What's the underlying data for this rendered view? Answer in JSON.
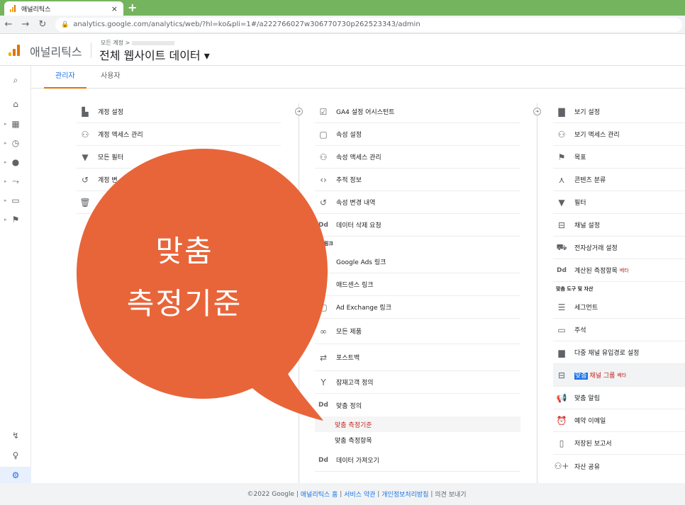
{
  "browser": {
    "tab_title": "애널리틱스",
    "tab_close": "×",
    "new_tab": "+",
    "url": "analytics.google.com/analytics/web/?hl=ko&pli=1#/a222766027w306770730p262523343/admin"
  },
  "header": {
    "app_name": "애널리틱스",
    "breadcrumb": "모든 계정 >",
    "property": "전체 웹사이트 데이터 ▾"
  },
  "subtabs": [
    "관리자",
    "사용자"
  ],
  "account_column": [
    {
      "icon": "building-icon",
      "label": "계정 설정"
    },
    {
      "icon": "people-icon",
      "label": "계정 액세스 관리"
    },
    {
      "icon": "filter-icon",
      "label": "모든 필터"
    },
    {
      "icon": "history-icon",
      "label": "계정 변"
    },
    {
      "icon": "trash-icon",
      "label": ""
    }
  ],
  "property_column": {
    "items": [
      {
        "icon": "check-icon",
        "label": "GA4 설정 어시스턴트"
      },
      {
        "icon": "window-icon",
        "label": "속성 설정"
      },
      {
        "icon": "people-icon",
        "label": "속성 액세스 관리"
      },
      {
        "icon": "code-icon",
        "label": "추적 정보"
      },
      {
        "icon": "history-icon",
        "label": "속성 변경 내역"
      },
      {
        "icon": "dd-icon",
        "label": "데이터 삭제 요청"
      }
    ],
    "section": "품 링크",
    "links": [
      {
        "icon": "ads-icon",
        "label": "Google Ads 링크"
      },
      {
        "icon": "adsense-icon",
        "label": "애드센스 링크"
      },
      {
        "icon": "adx-icon",
        "label": "Ad Exchange 링크"
      },
      {
        "icon": "all-products-icon",
        "label": "모든 제품"
      }
    ],
    "extra": [
      {
        "icon": "postback-icon",
        "label": "포스트백"
      },
      {
        "icon": "audience-icon",
        "label": "잠재고객 정의"
      },
      {
        "icon": "dd-icon",
        "label": "맞춤 정의"
      }
    ],
    "sub_items": [
      "맞춤 측정기준",
      "맞춤 측정항목"
    ],
    "last": {
      "icon": "dd-icon",
      "label": "데이터 가져오기"
    }
  },
  "view_column": {
    "items": [
      {
        "icon": "doc-icon",
        "label": "보기 설정"
      },
      {
        "icon": "people-icon",
        "label": "보기 액세스 관리"
      },
      {
        "icon": "flag-icon",
        "label": "목표"
      },
      {
        "icon": "grouping-icon",
        "label": "콘텐츠 분류"
      },
      {
        "icon": "filter-icon",
        "label": "필터"
      },
      {
        "icon": "channel-icon",
        "label": "채널 설정"
      },
      {
        "icon": "cart-icon",
        "label": "전자상거래 설정"
      },
      {
        "icon": "dd-icon",
        "label": "계산된 측정항목",
        "beta": "베타"
      }
    ],
    "section": "맞춤 도구 및 자산",
    "tools": [
      {
        "icon": "segment-icon",
        "label": "세그먼트"
      },
      {
        "icon": "annotation-icon",
        "label": "주석"
      },
      {
        "icon": "chart-icon",
        "label": "다중 채널 유입경로 설정"
      },
      {
        "icon": "channel-icon",
        "label_sel": "맞춤",
        "label_rest": " 채널 그룹",
        "beta": "베타"
      },
      {
        "icon": "megaphone-icon",
        "label": "맞춤 알림"
      },
      {
        "icon": "clock-icon",
        "label": "예약 이메일"
      },
      {
        "icon": "report-icon",
        "label": "저장된 보고서"
      },
      {
        "icon": "person-add-icon",
        "label": "자산 공유"
      }
    ]
  },
  "footer": {
    "copyright": "©2022 Google |",
    "home": "애널리틱스 홈",
    "terms": "서비스 약관",
    "privacy": "개인정보처리방침",
    "feedback": "의견 보내기",
    "sep": "|"
  },
  "overlay": {
    "line1": "맞춤",
    "line2": "측정기준",
    "color": "#e8653a"
  },
  "colors": {
    "accent": "#1a73e8",
    "tab_underline": "#e37400",
    "chrome_green": "#74b45e",
    "logo": [
      "#f9ab00",
      "#e37400",
      "#e37400"
    ]
  }
}
